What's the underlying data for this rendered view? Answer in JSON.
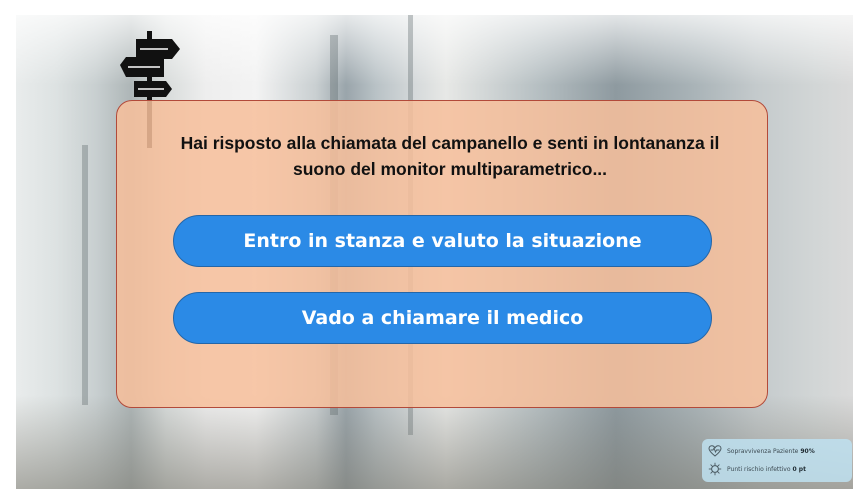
{
  "scenario": {
    "question": "Hai risposto alla chiamata del campanello e senti in lontananza il suono del monitor multiparametrico..."
  },
  "choices": [
    {
      "label": "Entro in stanza e valuto la situazione"
    },
    {
      "label": "Vado a chiamare il medico"
    }
  ],
  "status": {
    "survival_label": "Sopravvivenza Paziente",
    "survival_value": "90%",
    "infection_label": "Punti rischio infettivo",
    "infection_value": "0 pt"
  },
  "icons": {
    "signpost": "signpost-icon",
    "survival": "heart-monitor-icon",
    "infection": "virus-icon"
  },
  "colors": {
    "panel": "#f7bf9b",
    "panel_border": "#b24a3a",
    "button": "#2b8ae6",
    "button_text": "#ffffff"
  }
}
